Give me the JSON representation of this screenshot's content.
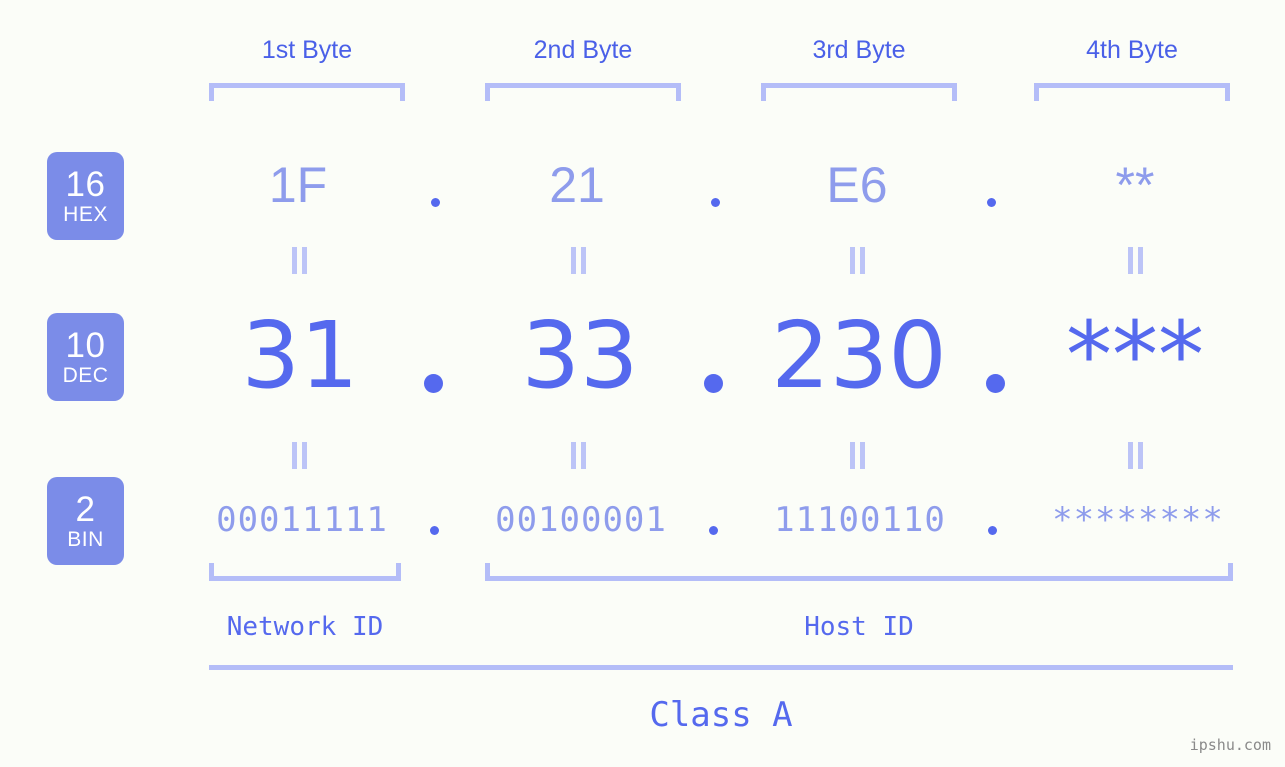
{
  "meta": {
    "watermark": "ipshu.com"
  },
  "byte_headers": [
    {
      "label": "1st Byte"
    },
    {
      "label": "2nd Byte"
    },
    {
      "label": "3rd Byte"
    },
    {
      "label": "4th Byte"
    }
  ],
  "radix_badges": [
    {
      "number": "16",
      "name": "HEX"
    },
    {
      "number": "10",
      "name": "DEC"
    },
    {
      "number": "2",
      "name": "BIN"
    }
  ],
  "rows": {
    "hex": {
      "radix": "16",
      "radix_name": "HEX",
      "values": [
        "1F",
        "21",
        "E6",
        "**"
      ],
      "separator": "."
    },
    "dec": {
      "radix": "10",
      "radix_name": "DEC",
      "values": [
        "31",
        "33",
        "230",
        "***"
      ],
      "separator": "."
    },
    "bin": {
      "radix": "2",
      "radix_name": "BIN",
      "values": [
        "00011111",
        "00100001",
        "11100110",
        "********"
      ],
      "separator": "."
    }
  },
  "equals_marks": {
    "glyph": "||",
    "count_per_gap": 4
  },
  "segments": {
    "network_id": "Network ID",
    "host_id": "Host ID",
    "class": "Class A"
  },
  "colors": {
    "background": "#fbfdf8",
    "badge_fill": "#7b8ce8",
    "badge_text": "#ffffff",
    "header_text": "#4a60e8",
    "bracket": "#b4bdf8",
    "hex_text": "#8e9cec",
    "dec_text": "#5569ee",
    "bin_text": "#8e9cec",
    "dot": "#5569ee",
    "equals": "#bcc4f7",
    "label_text": "#5569ee",
    "watermark_text": "#8a8a8a"
  }
}
